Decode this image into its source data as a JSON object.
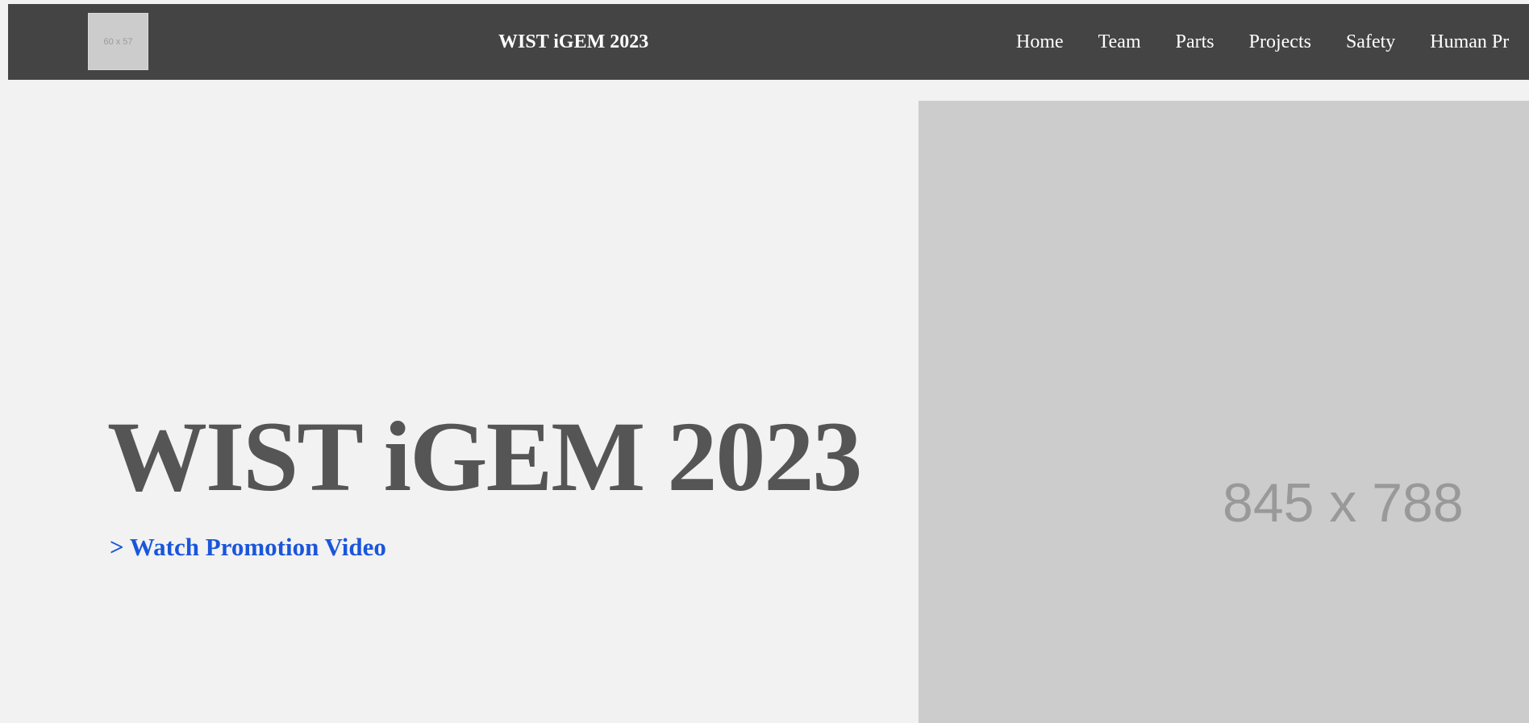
{
  "colors": {
    "navbar_bg": "#444444",
    "page_bg": "#f2f2f2",
    "placeholder_bg": "#cccccc",
    "placeholder_text": "#999999",
    "hero_title": "#555555",
    "link": "#1a56db"
  },
  "header": {
    "logo_placeholder_text": "60 x 57",
    "title": "WIST iGEM 2023",
    "nav": [
      {
        "label": "Home"
      },
      {
        "label": "Team"
      },
      {
        "label": "Parts"
      },
      {
        "label": "Projects"
      },
      {
        "label": "Safety"
      },
      {
        "label": "Human Pr"
      }
    ]
  },
  "hero": {
    "title": "WIST iGEM 2023",
    "link_text": "> Watch Promotion Video",
    "image_placeholder_text": "845 x 788"
  }
}
